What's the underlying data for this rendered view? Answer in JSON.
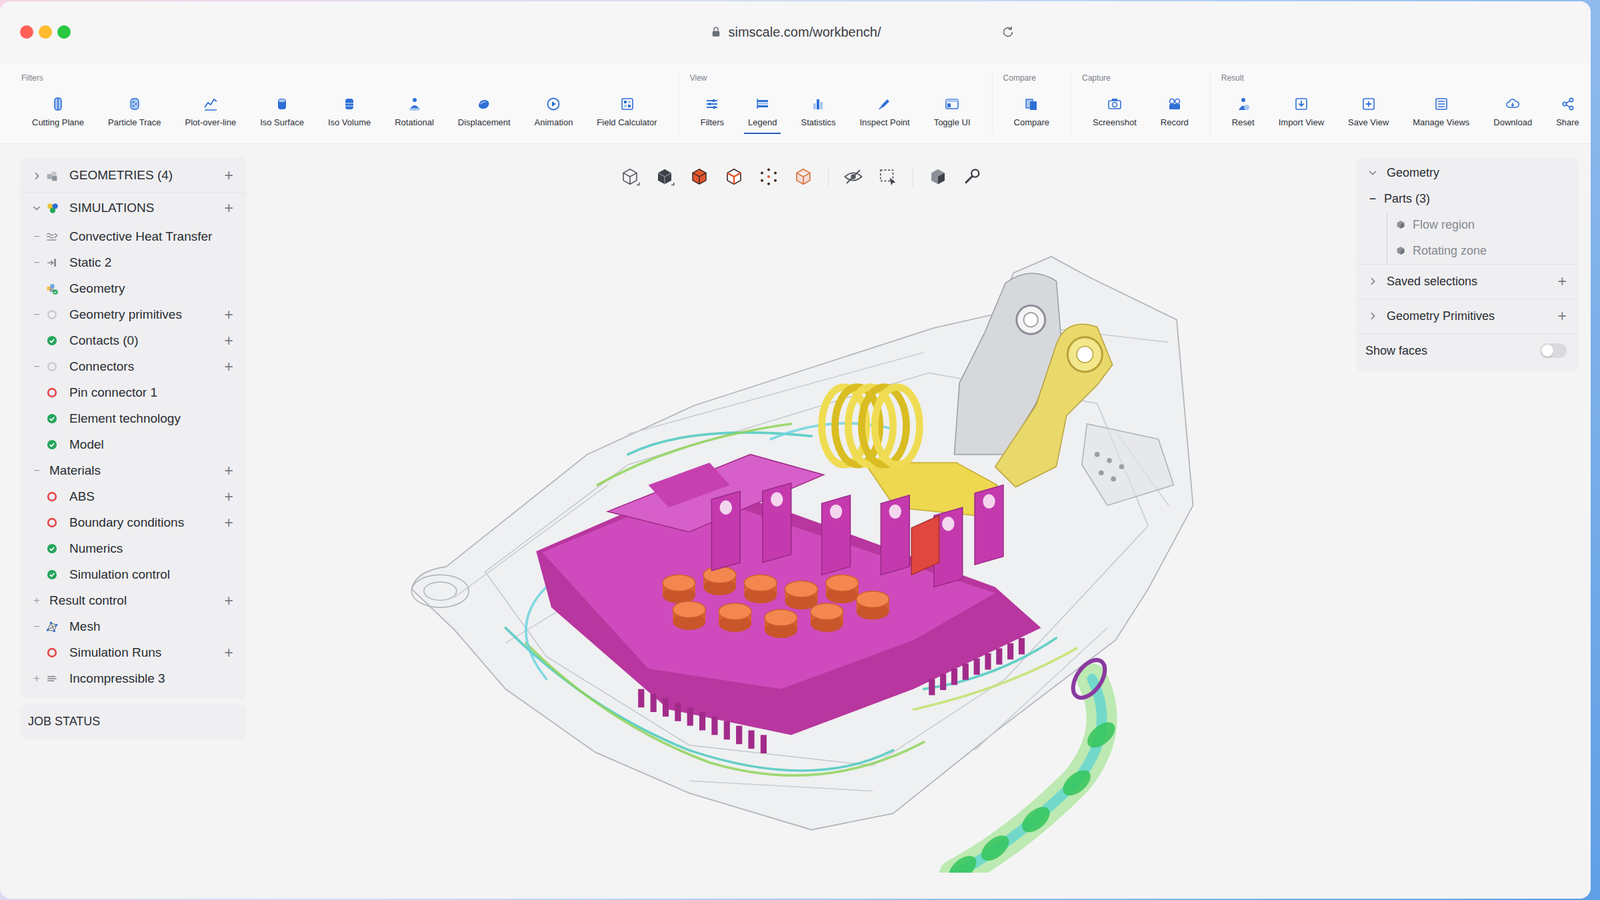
{
  "browser": {
    "url": "simscale.com/workbench/"
  },
  "toolbar": {
    "groups": [
      {
        "label": "Filters",
        "tools": [
          {
            "label": "Cutting Plane",
            "selected": false
          },
          {
            "label": "Particle Trace",
            "selected": false
          },
          {
            "label": "Plot-over-line",
            "selected": false
          },
          {
            "label": "Iso Surface",
            "selected": false
          },
          {
            "label": "Iso Volume",
            "selected": false
          },
          {
            "label": "Rotational",
            "selected": false
          },
          {
            "label": "Displacement",
            "selected": false
          },
          {
            "label": "Animation",
            "selected": false
          },
          {
            "label": "Field Calculator",
            "selected": false
          }
        ]
      },
      {
        "label": "View",
        "tools": [
          {
            "label": "Filters",
            "selected": false
          },
          {
            "label": "Legend",
            "selected": true
          },
          {
            "label": "Statistics",
            "selected": false
          },
          {
            "label": "Inspect Point",
            "selected": false
          },
          {
            "label": "Toggle UI",
            "selected": false
          }
        ]
      },
      {
        "label": "Compare",
        "tools": [
          {
            "label": "Compare",
            "selected": false
          }
        ]
      },
      {
        "label": "Capture",
        "tools": [
          {
            "label": "Screenshot",
            "selected": false
          },
          {
            "label": "Record",
            "selected": false
          }
        ]
      },
      {
        "label": "Result",
        "tools": [
          {
            "label": "Reset",
            "selected": false
          },
          {
            "label": "Import View",
            "selected": false
          },
          {
            "label": "Save View",
            "selected": false
          },
          {
            "label": "Manage Views",
            "selected": false
          },
          {
            "label": "Download",
            "selected": false
          },
          {
            "label": "Share",
            "selected": false
          }
        ]
      }
    ]
  },
  "sidebar": {
    "sections": [
      {
        "label": "GEOMETRIES (4)",
        "expanded": false,
        "add": "+"
      },
      {
        "label": "SIMULATIONS",
        "expanded": true,
        "add": "+",
        "items": [
          {
            "label": "Convective Heat Transfer",
            "toggle": "−",
            "kind": "heat"
          },
          {
            "label": "Static 2",
            "toggle": "−",
            "kind": "static"
          },
          {
            "label": "Geometry",
            "kind": "geometry"
          },
          {
            "label": "Geometry primitives",
            "toggle": "−",
            "kind": "pending",
            "add": "+"
          },
          {
            "label": "Contacts (0)",
            "kind": "ok",
            "add": "+"
          },
          {
            "label": "Connectors",
            "toggle": "−",
            "kind": "pending",
            "add": "+"
          },
          {
            "label": "Pin connector 1",
            "kind": "error"
          },
          {
            "label": "Element technology",
            "kind": "ok"
          },
          {
            "label": "Model",
            "kind": "ok"
          },
          {
            "label": "Materials",
            "toggle": "−",
            "kind": "plain",
            "add": "+"
          },
          {
            "label": "ABS",
            "kind": "error",
            "add": "+"
          },
          {
            "label": "Boundary conditions",
            "kind": "error",
            "add": "+"
          },
          {
            "label": "Numerics",
            "kind": "ok"
          },
          {
            "label": "Simulation control",
            "kind": "ok"
          },
          {
            "label": "Result control",
            "toggle": "+",
            "kind": "plain",
            "add": "+"
          },
          {
            "label": "Mesh",
            "toggle": "−",
            "kind": "mesh"
          },
          {
            "label": "Simulation Runs",
            "kind": "error",
            "add": "+"
          },
          {
            "label": "Incompressible 3",
            "toggle": "+",
            "kind": "incompressible"
          }
        ]
      }
    ],
    "job_status": {
      "label": "JOB STATUS"
    }
  },
  "right_panel": {
    "geometry": {
      "label": "Geometry",
      "expanded": true,
      "parts": {
        "label": "Parts (3)",
        "toggle": "−",
        "items": [
          {
            "label": "Flow region"
          },
          {
            "label": "Rotating zone"
          }
        ]
      }
    },
    "sections": [
      {
        "label": "Saved selections",
        "expanded": false,
        "add": "+"
      },
      {
        "label": "Geometry Primitives",
        "expanded": false,
        "add": "+"
      }
    ],
    "show_faces": {
      "label": "Show faces",
      "on": false
    }
  }
}
